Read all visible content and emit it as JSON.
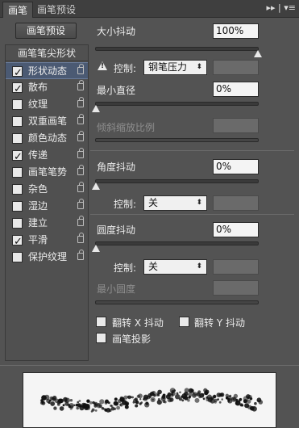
{
  "tabs": [
    {
      "label": "画笔",
      "active": true
    },
    {
      "label": "画笔预设",
      "active": false
    }
  ],
  "panel_menu": "▸▸ | ▾≡",
  "preset_button": "画笔预设",
  "left_header": "画笔笔尖形状",
  "left_items": [
    {
      "label": "形状动态",
      "checked": true,
      "selected": true
    },
    {
      "label": "散布",
      "checked": true,
      "selected": false
    },
    {
      "label": "纹理",
      "checked": false,
      "selected": false
    },
    {
      "label": "双重画笔",
      "checked": false,
      "selected": false
    },
    {
      "label": "颜色动态",
      "checked": false,
      "selected": false
    },
    {
      "label": "传递",
      "checked": true,
      "selected": false
    },
    {
      "label": "画笔笔势",
      "checked": false,
      "selected": false
    },
    {
      "label": "杂色",
      "checked": false,
      "selected": false
    },
    {
      "label": "湿边",
      "checked": false,
      "selected": false
    },
    {
      "label": "建立",
      "checked": false,
      "selected": false
    },
    {
      "label": "平滑",
      "checked": true,
      "selected": false
    },
    {
      "label": "保护纹理",
      "checked": false,
      "selected": false
    }
  ],
  "size_jitter": {
    "label": "大小抖动",
    "value": "100%",
    "slider": 1.0
  },
  "control1": {
    "label": "控制:",
    "value": "钢笔压力"
  },
  "min_diameter": {
    "label": "最小直径",
    "value": "0%",
    "slider": 0.0
  },
  "tilt_scale": {
    "label": "倾斜缩放比例",
    "value": ""
  },
  "angle_jitter": {
    "label": "角度抖动",
    "value": "0%",
    "slider": 0.0
  },
  "control2": {
    "label": "控制:",
    "value": "关"
  },
  "roundness_jitter": {
    "label": "圆度抖动",
    "value": "0%",
    "slider": 0.0
  },
  "control3": {
    "label": "控制:",
    "value": "关"
  },
  "min_roundness": {
    "label": "最小圆度",
    "value": ""
  },
  "flip_x": {
    "label": "翻转 X 抖动",
    "checked": false
  },
  "flip_y": {
    "label": "翻转 Y 抖动",
    "checked": false
  },
  "brush_projection": {
    "label": "画笔投影",
    "checked": false
  }
}
